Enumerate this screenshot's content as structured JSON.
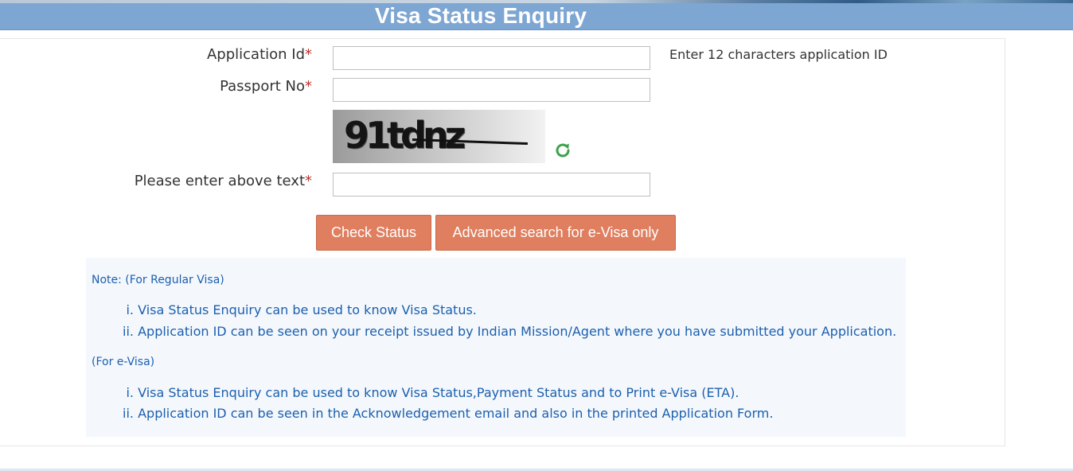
{
  "header": {
    "title": "Visa Status Enquiry"
  },
  "form": {
    "application_id": {
      "label": "Application Id",
      "required_mark": "*",
      "value": "",
      "hint": "Enter 12 characters application ID"
    },
    "passport_no": {
      "label": "Passport No",
      "required_mark": "*",
      "value": ""
    },
    "captcha": {
      "image_text": "91tdnz",
      "refresh_icon": "refresh-icon"
    },
    "captcha_input": {
      "label": "Please enter above text",
      "required_mark": "*",
      "value": ""
    },
    "buttons": {
      "check_status": "Check Status",
      "advanced_search": "Advanced search for e-Visa only"
    }
  },
  "notes": {
    "regular_heading": "Note: (For Regular Visa)",
    "regular_items": [
      {
        "num": "i.",
        "text": "Visa Status Enquiry can be used to know Visa Status."
      },
      {
        "num": "ii.",
        "text": "Application ID can be seen on your receipt issued by Indian Mission/Agent where you have submitted your Application."
      }
    ],
    "evisa_heading": "(For e-Visa)",
    "evisa_items": [
      {
        "num": "i.",
        "text": "Visa Status Enquiry can be used to know Visa Status,Payment Status and to Print e-Visa (ETA)."
      },
      {
        "num": "ii.",
        "text": "Application ID can be seen in the Acknowledgement email and also in the printed Application Form."
      }
    ]
  },
  "colors": {
    "header_bg": "#7ea6d3",
    "button_bg": "#df7f5f",
    "note_text": "#1c5fae",
    "note_bg": "#f4f8fd",
    "required_mark": "#b8322e"
  }
}
